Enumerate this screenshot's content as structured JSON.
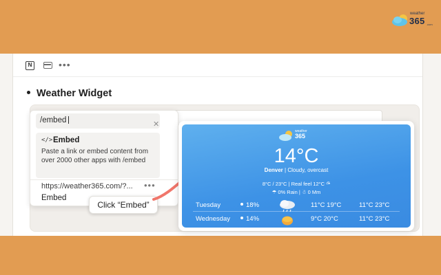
{
  "brand": {
    "small": "weather",
    "big": "365",
    "suffix": ".com"
  },
  "page": {
    "heading": "Weather Widget"
  },
  "icons": [
    "notion-icon",
    "window-icon",
    "more-icon",
    "code-icon",
    "close-icon",
    "cloud-rain-icon",
    "sun-icon"
  ],
  "embed_menu": {
    "command": "/embed",
    "option_code": "</>",
    "option_title": "Embed",
    "option_description": "Paste a link or embed content from over 2000 other apps with /embed",
    "url": "https://weather365.com/?...",
    "more": "•••",
    "action": "Embed"
  },
  "tooltip": "Click “Embed”",
  "widget": {
    "logo_small": "weather",
    "logo_big": "365",
    "temperature": "14°C",
    "location": "Denver",
    "condition": " | Cloudy, overcast",
    "details_line1": "8°C / 23°C | Real feel 12°C ⛅︎",
    "details_line2": "☂ 0% Rain | ☃ 0 Mm",
    "forecast": [
      {
        "day": "Tuesday",
        "rain": "18%",
        "icon": "cloud-rain-icon",
        "temp1": "11°C 19°C",
        "temp2": "11°C 23°C"
      },
      {
        "day": "Wednesday",
        "rain": "14%",
        "icon": "sun-icon",
        "temp1": "9°C 20°C",
        "temp2": "11°C 23°C"
      }
    ]
  },
  "colors": {
    "background": "#e29c52",
    "widget_blue": "#3d92e6",
    "arrow": "#f0766b"
  }
}
